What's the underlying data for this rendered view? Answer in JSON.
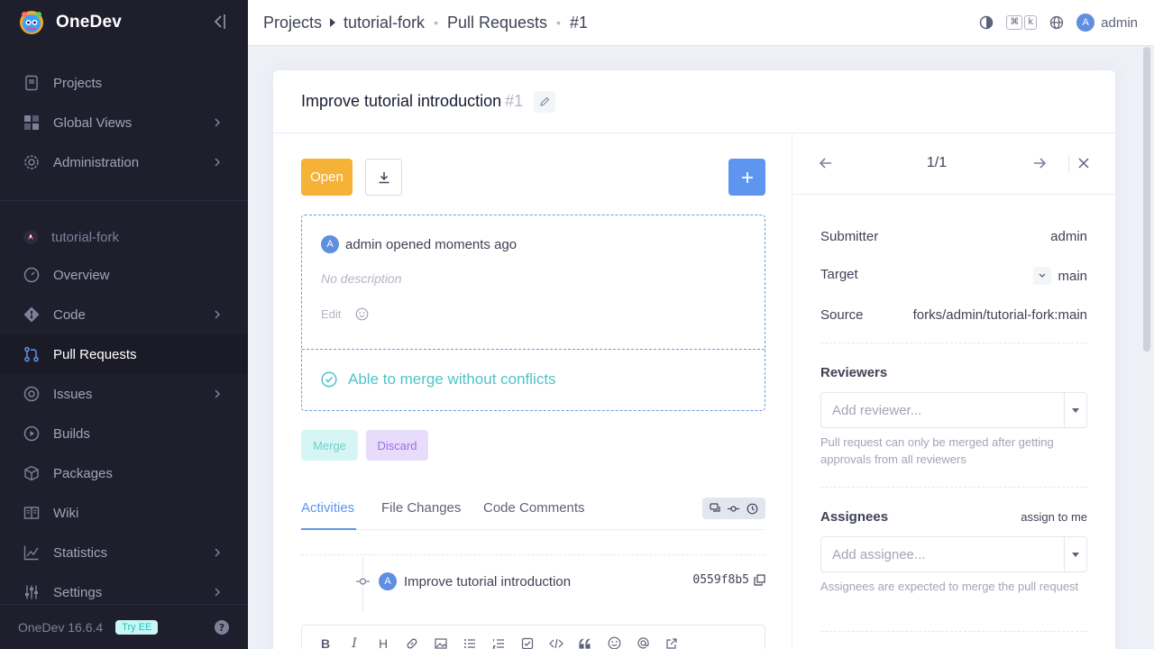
{
  "app": {
    "name": "OneDev",
    "version": "OneDev 16.6.4",
    "try_ee": "Try EE"
  },
  "sidebar": {
    "top_items": [
      {
        "label": "Projects",
        "icon": "projects-icon",
        "has_children": false
      },
      {
        "label": "Global Views",
        "icon": "grid-icon",
        "has_children": true
      },
      {
        "label": "Administration",
        "icon": "gear-icon",
        "has_children": true
      }
    ],
    "project": {
      "label": "tutorial-fork",
      "icon": "rocket-icon"
    },
    "project_items": [
      {
        "label": "Overview",
        "icon": "gauge-icon",
        "has_children": false
      },
      {
        "label": "Code",
        "icon": "git-icon",
        "has_children": true
      },
      {
        "label": "Pull Requests",
        "icon": "pull-request-icon",
        "has_children": false,
        "active": true
      },
      {
        "label": "Issues",
        "icon": "issue-icon",
        "has_children": true
      },
      {
        "label": "Builds",
        "icon": "play-icon",
        "has_children": false
      },
      {
        "label": "Packages",
        "icon": "package-icon",
        "has_children": false
      },
      {
        "label": "Wiki",
        "icon": "book-icon",
        "has_children": false
      },
      {
        "label": "Statistics",
        "icon": "chart-icon",
        "has_children": true
      },
      {
        "label": "Settings",
        "icon": "sliders-icon",
        "has_children": true
      }
    ]
  },
  "breadcrumb": {
    "projects": "Projects",
    "project": "tutorial-fork",
    "section": "Pull Requests",
    "number": "#1"
  },
  "topbar": {
    "kbd_cmd": "⌘",
    "kbd_k": "k",
    "user_initial": "A",
    "user_name": "admin"
  },
  "pr": {
    "title": "Improve tutorial introduction",
    "number": "#1",
    "open_label": "Open",
    "add_label": "+",
    "opened_initial": "A",
    "opened_text": "admin opened moments ago",
    "no_description": "No description",
    "edit_label": "Edit",
    "merge_status": "Able to merge without conflicts",
    "merge_label": "Merge",
    "discard_label": "Discard"
  },
  "tabs": [
    {
      "label": "Activities",
      "active": true
    },
    {
      "label": "File Changes",
      "active": false
    },
    {
      "label": "Code Comments",
      "active": false
    }
  ],
  "activity": {
    "initial": "A",
    "commit_message": "Improve tutorial introduction",
    "commit_hash": "0559f8b5"
  },
  "editor_toolbar": {
    "bold": "B",
    "italic": "I",
    "heading": "H"
  },
  "side": {
    "nav_count": "1/1",
    "submitter_label": "Submitter",
    "submitter_value": "admin",
    "target_label": "Target",
    "target_value": "main",
    "source_label": "Source",
    "source_value": "forks/admin/tutorial-fork:main",
    "reviewers_title": "Reviewers",
    "reviewer_placeholder": "Add reviewer...",
    "reviewers_hint": "Pull request can only be merged after getting approvals from all reviewers",
    "assignees_title": "Assignees",
    "assign_to_me": "assign to me",
    "assignee_placeholder": "Add assignee...",
    "assignees_hint": "Assignees are expected to merge the pull request"
  },
  "colors": {
    "accent": "#5e95ee",
    "open": "#f5b236",
    "sidebar": "#1e1e2d",
    "success": "#4fc3c8"
  }
}
